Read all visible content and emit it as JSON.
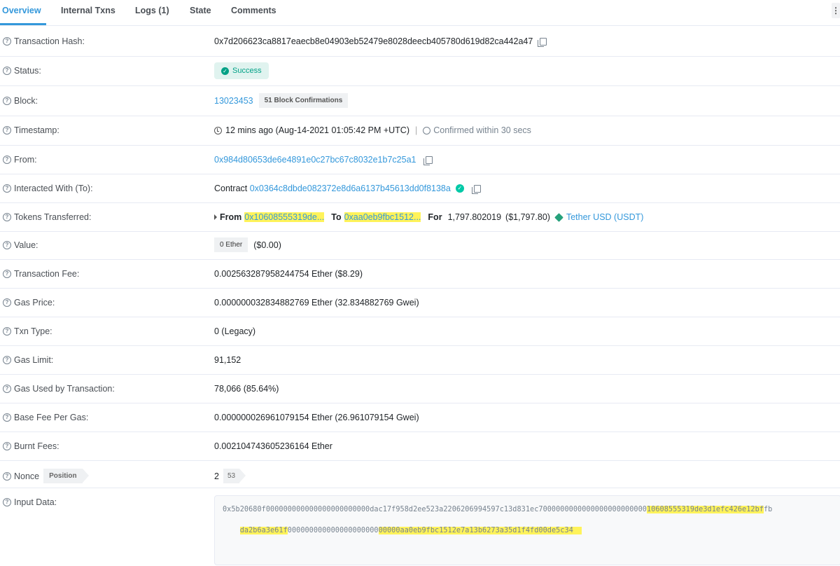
{
  "tabs": [
    "Overview",
    "Internal Txns",
    "Logs (1)",
    "State",
    "Comments"
  ],
  "menu_icon": "⋮",
  "labels": {
    "hash": "Transaction Hash:",
    "status": "Status:",
    "block": "Block:",
    "timestamp": "Timestamp:",
    "from": "From:",
    "to": "Interacted With (To):",
    "tokens": "Tokens Transferred:",
    "value": "Value:",
    "fee": "Transaction Fee:",
    "gas_price": "Gas Price:",
    "txn_type": "Txn Type:",
    "gas_limit": "Gas Limit:",
    "gas_used": "Gas Used by Transaction:",
    "base_fee": "Base Fee Per Gas:",
    "burnt": "Burnt Fees:",
    "nonce": "Nonce",
    "input": "Input Data:"
  },
  "tx": {
    "hash": "0x7d206623ca8817eaecb8e04903eb52479e8028deecb405780d619d82ca442a47",
    "status": "Success",
    "block": "13023453",
    "confirmations": "51 Block Confirmations",
    "time_ago": "12 mins ago (Aug-14-2021 01:05:42 PM +UTC)",
    "confirmed_within": "Confirmed within 30 secs",
    "from": "0x984d80653de6e4891e0c27bc67c8032e1b7c25a1",
    "contract_prefix": "Contract",
    "contract": "0x0364c8dbde082372e8d6a6137b45613dd0f8138a",
    "token": {
      "from_label": "From",
      "from_addr": "0x10608555319de...",
      "to_label": "To",
      "to_addr": "0xaa0eb9fbc1512...",
      "for_label": "For",
      "amount": "1,797.802019",
      "usd": "($1,797.80)",
      "name": "Tether USD (USDT)"
    },
    "value_chip": "0 Ether",
    "value_usd": "($0.00)",
    "fee": "0.002563287958244754 Ether ($8.29)",
    "gas_price": "0.000000032834882769 Ether (32.834882769 Gwei)",
    "txn_type": "0 (Legacy)",
    "gas_limit": "91,152",
    "gas_used": "78,066 (85.64%)",
    "base_fee": "0.000000026961079154 Ether (26.961079154 Gwei)",
    "burnt": "0.002104743605236164 Ether",
    "nonce_position_label": "Position",
    "nonce": "2",
    "position": "53",
    "input_line1_a": "0x5b20680f000000000000000000000000dac17f958d2ee523a2206206994597c13d831ec7000000000000000000000000",
    "input_line1_hl": "10608555319de3d1efc426e12bf",
    "input_line1_b": "fb",
    "input_line2_hl1": "da2b6a3e61f",
    "input_line2_a": "000000000000000000000",
    "input_line2_hl2": "00000aa0eb9fbc1512e7a13b6273a35d1f4fd00de5c34  "
  }
}
